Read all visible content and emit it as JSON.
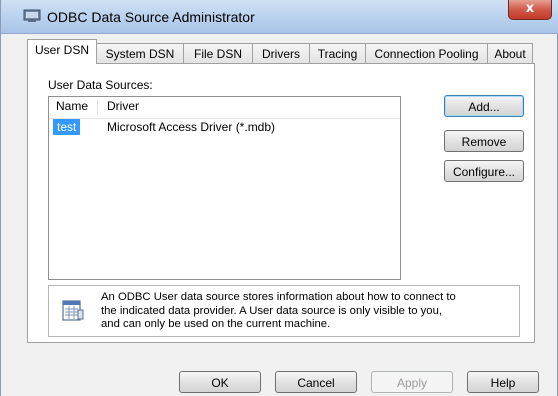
{
  "window": {
    "title": "ODBC Data Source Administrator",
    "close_symbol": "x"
  },
  "tabs": [
    {
      "label": "User DSN",
      "selected": true
    },
    {
      "label": "System DSN",
      "selected": false
    },
    {
      "label": "File DSN",
      "selected": false
    },
    {
      "label": "Drivers",
      "selected": false
    },
    {
      "label": "Tracing",
      "selected": false
    },
    {
      "label": "Connection Pooling",
      "selected": false
    },
    {
      "label": "About",
      "selected": false
    }
  ],
  "user_dsn": {
    "list_label": "User Data Sources:",
    "columns": [
      "Name",
      "Driver"
    ],
    "rows": [
      {
        "name": "test",
        "driver": "Microsoft Access Driver (*.mdb)",
        "selected": true
      }
    ],
    "buttons": {
      "add": "Add...",
      "remove": "Remove",
      "configure": "Configure..."
    },
    "info_text": "An ODBC User data source stores information about how to connect to\nthe indicated data provider.   A User data source is only visible to you,\nand can only be used on the current machine."
  },
  "footer": {
    "ok": "OK",
    "cancel": "Cancel",
    "apply": "Apply",
    "help": "Help"
  },
  "colors": {
    "selection": "#3399ff",
    "titlebar": "#b9d1ee",
    "close_button": "#d2594a"
  },
  "icons": {
    "app": "odbc-admin-icon",
    "info": "data-source-info-icon",
    "close": "close-icon"
  }
}
